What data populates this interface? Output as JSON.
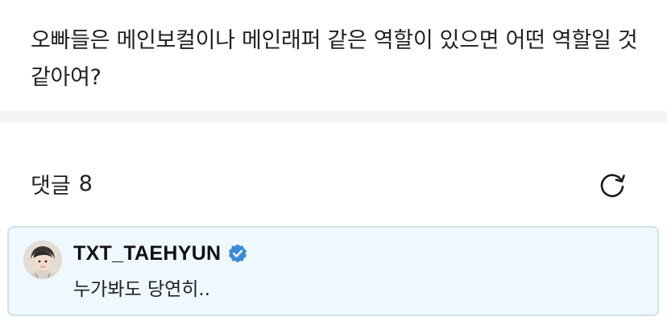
{
  "question": {
    "text": "오빠들은 메인보컬이나 메인래퍼 같은 역할이 있으면 어떤 역할일 것 같아여?"
  },
  "comments": {
    "label": "댓글",
    "count": "8",
    "refresh_icon": "refresh-icon"
  },
  "comment": {
    "author": "TXT_TAEHYUN",
    "verified_icon": "verified-badge-icon",
    "body": "누가봐도 당연히..",
    "background_color": "#eef8fe",
    "border_color": "#cfe3ee"
  },
  "colors": {
    "verified": "#3b8bd9",
    "divider": "#f4f4f7"
  }
}
